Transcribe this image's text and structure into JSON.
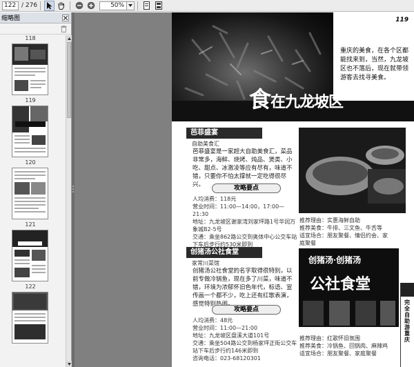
{
  "toolbar": {
    "current_page": "122",
    "total_pages": "/ 276",
    "zoom": "50%"
  },
  "sidebar": {
    "title": "缩略图",
    "thumbnails": [
      {
        "label": "118"
      },
      {
        "label": "119"
      },
      {
        "label": "120"
      },
      {
        "label": "121"
      },
      {
        "label": "122"
      }
    ]
  },
  "page": {
    "page_number": "119",
    "intro": "重庆的美食，在各个区都能找来到，当然，九龙坡区也不落后，现在就带领游客去找寻美食。",
    "hero_title_big": "食",
    "hero_title_rest": "在九龙坡区",
    "section1": {
      "title": "芭菲盛宴",
      "subtitle": "自助美食汇",
      "body": "芭菲盛宴是一家超大自助美食汇，菜品非常多，海鲜、烧烤、炖品、煲类、小吃、甜点、冰激凌等应有尽有，味道不错，只要你不怕太撑就一定吃得很尽兴。",
      "guide_label": "攻略要点",
      "info": [
        "人均消费：118元",
        "营业时间：11:00—14:00，17:00—21:30",
        "地址：九龙坡区谢家湾刘家坪路1号华润万象城B2-5号",
        "交通：乘坐862路公交到奥体中心公交车站下车后步行约530米即到",
        "咨询电话：023-68103333"
      ],
      "right_info": [
        "推荐理由：实惠海鲜自助",
        "推荐美食：牛排、三文鱼、牛舌等",
        "适宜场合：朋友聚餐、情侣约会、家庭聚餐"
      ]
    },
    "section2": {
      "title": "创猪汤公社食堂",
      "subtitle": "家常川菜馆",
      "body": "创猪汤公社食堂的名字取得很特别，以前专做冷锅鱼，现在多了川菜，味道不错，环境为浓郁怀旧色年代，标语、宣传画一个都不少，吃上还有红歌表演，感觉特别热闹。",
      "guide_label": "攻略要点",
      "sign_text": "公社食堂",
      "sign_top_text": "创猪汤·创猪汤",
      "info": [
        "人均消费：48元",
        "营业时间：11:00—21:00",
        "地址：九龙坡区盘溪大道101号",
        "交通：乘坐504路公交到杨家坪正街公交车站下车后步行约146米即到",
        "咨询电话：023-68120301"
      ],
      "right_info": [
        "推荐理由：红歌怀旧氛围",
        "推荐美食：冷锅鱼、回锅肉、麻辣鸡",
        "适宜场合：朋友聚餐、家庭聚餐"
      ]
    },
    "side_strip": "完全自助游重庆"
  }
}
